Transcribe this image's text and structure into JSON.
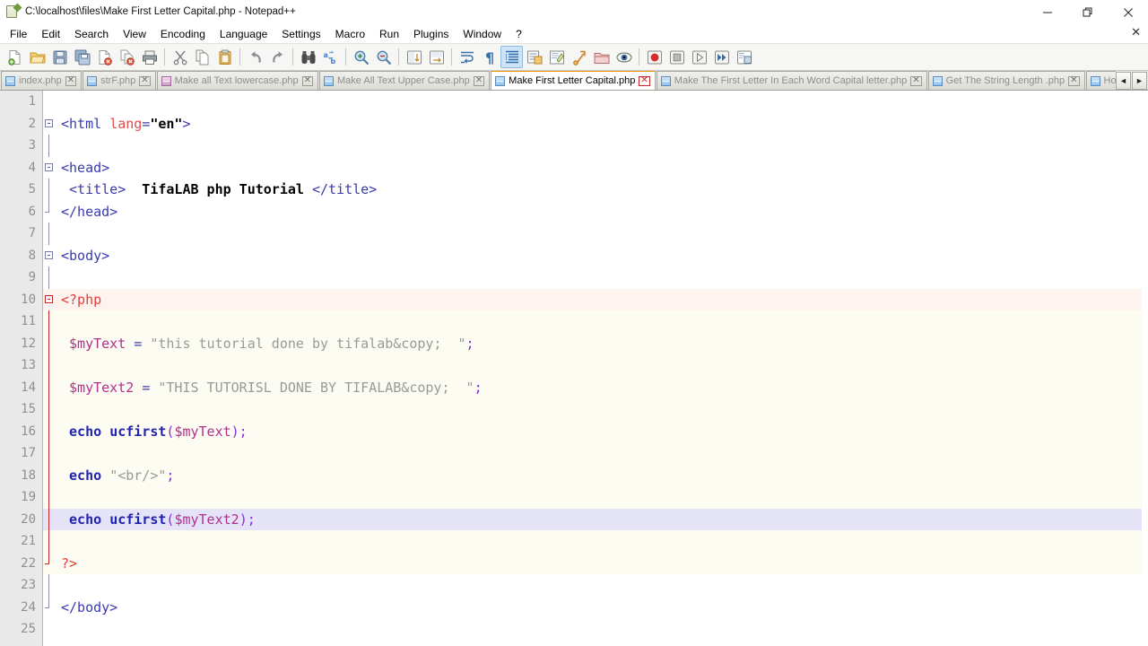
{
  "window": {
    "title": "C:\\localhost\\files\\Make First Letter Capital.php - Notepad++",
    "icon": "notepadpp-icon",
    "minimize_label": "—",
    "restore_label": "❐",
    "close_label": "✕",
    "doc_close_label": "✕"
  },
  "menu": {
    "items": [
      {
        "label": "File"
      },
      {
        "label": "Edit"
      },
      {
        "label": "Search"
      },
      {
        "label": "View"
      },
      {
        "label": "Encoding"
      },
      {
        "label": "Language"
      },
      {
        "label": "Settings"
      },
      {
        "label": "Macro"
      },
      {
        "label": "Run"
      },
      {
        "label": "Plugins"
      },
      {
        "label": "Window"
      },
      {
        "label": "?"
      }
    ]
  },
  "toolbar": {
    "buttons": [
      {
        "name": "new-file",
        "icon": "new-document-icon"
      },
      {
        "name": "open-file",
        "icon": "open-folder-icon"
      },
      {
        "name": "save-file",
        "icon": "floppy-save-icon"
      },
      {
        "name": "save-all",
        "icon": "save-all-icon"
      },
      {
        "name": "close-file",
        "icon": "close-document-icon"
      },
      {
        "name": "close-all",
        "icon": "close-all-documents-icon"
      },
      {
        "name": "print",
        "icon": "printer-icon"
      },
      {
        "name": "separator-1",
        "icon": "separator"
      },
      {
        "name": "cut",
        "icon": "scissors-icon"
      },
      {
        "name": "copy",
        "icon": "copy-pages-icon"
      },
      {
        "name": "paste",
        "icon": "clipboard-paste-icon"
      },
      {
        "name": "separator-2",
        "icon": "separator"
      },
      {
        "name": "undo",
        "icon": "undo-arrow-icon"
      },
      {
        "name": "redo",
        "icon": "redo-arrow-icon"
      },
      {
        "name": "separator-3",
        "icon": "separator"
      },
      {
        "name": "find",
        "icon": "binoculars-icon"
      },
      {
        "name": "replace",
        "icon": "replace-ab-icon"
      },
      {
        "name": "separator-4",
        "icon": "separator"
      },
      {
        "name": "zoom-in",
        "icon": "zoom-in-icon"
      },
      {
        "name": "zoom-out",
        "icon": "zoom-out-icon"
      },
      {
        "name": "separator-5",
        "icon": "separator"
      },
      {
        "name": "sync-vertical-scroll",
        "icon": "sync-vertical-icon"
      },
      {
        "name": "sync-horizontal-scroll",
        "icon": "sync-horizontal-icon"
      },
      {
        "name": "separator-6",
        "icon": "separator"
      },
      {
        "name": "word-wrap",
        "icon": "word-wrap-icon"
      },
      {
        "name": "show-all-characters",
        "icon": "pilcrow-icon"
      },
      {
        "name": "show-indent-guide",
        "icon": "indent-guide-icon",
        "active": true
      },
      {
        "name": "user-defined-dialog",
        "icon": "user-define-icon"
      },
      {
        "name": "document-map",
        "icon": "document-map-icon"
      },
      {
        "name": "function-list",
        "icon": "function-list-icon"
      },
      {
        "name": "folder-as-workspace",
        "icon": "folder-workspace-icon"
      },
      {
        "name": "monitoring",
        "icon": "eye-monitor-icon"
      },
      {
        "name": "separator-7",
        "icon": "separator"
      },
      {
        "name": "start-recording",
        "icon": "record-macro-icon"
      },
      {
        "name": "stop-recording",
        "icon": "stop-macro-icon"
      },
      {
        "name": "play-macro",
        "icon": "play-macro-icon"
      },
      {
        "name": "run-macro-multiple",
        "icon": "fast-forward-macro-icon"
      },
      {
        "name": "save-macro",
        "icon": "save-macro-icon"
      }
    ]
  },
  "tabs": {
    "items": [
      {
        "label": "index.php",
        "active": false,
        "modified": false
      },
      {
        "label": "strF.php",
        "active": false,
        "modified": false
      },
      {
        "label": "Make all Text lowercase.php",
        "active": false,
        "modified": true
      },
      {
        "label": "Make All Text Upper Case.php",
        "active": false,
        "modified": false
      },
      {
        "label": "Make First Letter Capital.php",
        "active": true,
        "modified": false
      },
      {
        "label": "Make The First Letter In Each Word Capital letter.php",
        "active": false,
        "modified": false
      },
      {
        "label": "Get The String Length .php",
        "active": false,
        "modified": false
      },
      {
        "label": "How To Trim a Text.php",
        "active": false,
        "modified": false
      }
    ],
    "close_mark": "✕",
    "scroll_left": "◄",
    "scroll_right": "►"
  },
  "editor": {
    "active_line": 20,
    "caret_line": 20,
    "caret_column": 28,
    "lines": [
      {
        "num": "1",
        "tokens": []
      },
      {
        "num": "2",
        "tokens": [
          {
            "t": "tag",
            "s": "<html"
          },
          {
            "t": "plain",
            "s": " "
          },
          {
            "t": "attr",
            "s": "lang"
          },
          {
            "t": "op",
            "s": "="
          },
          {
            "t": "val",
            "s": "\"en\""
          },
          {
            "t": "tag",
            "s": ">"
          }
        ]
      },
      {
        "num": "3",
        "tokens": []
      },
      {
        "num": "4",
        "tokens": [
          {
            "t": "tag",
            "s": "<head>"
          }
        ]
      },
      {
        "num": "5",
        "tokens": [
          {
            "t": "tag",
            "s": " <title>"
          },
          {
            "t": "strb",
            "s": "  TifaLAB php Tutorial "
          },
          {
            "t": "tag",
            "s": "</title>"
          }
        ]
      },
      {
        "num": "6",
        "tokens": [
          {
            "t": "tag",
            "s": "</head>"
          }
        ]
      },
      {
        "num": "7",
        "tokens": []
      },
      {
        "num": "8",
        "tokens": [
          {
            "t": "tag",
            "s": "<body>"
          }
        ]
      },
      {
        "num": "9",
        "tokens": []
      },
      {
        "num": "10",
        "tokens": [
          {
            "t": "php",
            "s": "<?php"
          }
        ]
      },
      {
        "num": "11",
        "tokens": []
      },
      {
        "num": "12",
        "tokens": [
          {
            "t": "var",
            "s": " $myText"
          },
          {
            "t": "plain",
            "s": " "
          },
          {
            "t": "op",
            "s": "="
          },
          {
            "t": "plain",
            "s": " "
          },
          {
            "t": "str",
            "s": "\"this tutorial done by tifalab&copy;  \""
          },
          {
            "t": "punct",
            "s": ";"
          }
        ]
      },
      {
        "num": "13",
        "tokens": []
      },
      {
        "num": "14",
        "tokens": [
          {
            "t": "var",
            "s": " $myText2"
          },
          {
            "t": "plain",
            "s": " "
          },
          {
            "t": "op",
            "s": "="
          },
          {
            "t": "plain",
            "s": " "
          },
          {
            "t": "str",
            "s": "\"THIS TUTORISL DONE BY TIFALAB&copy;  \""
          },
          {
            "t": "punct",
            "s": ";"
          }
        ]
      },
      {
        "num": "15",
        "tokens": []
      },
      {
        "num": "16",
        "tokens": [
          {
            "t": "kw",
            "s": " echo"
          },
          {
            "t": "plain",
            "s": " "
          },
          {
            "t": "fn",
            "s": "ucfirst"
          },
          {
            "t": "punct",
            "s": "("
          },
          {
            "t": "var",
            "s": "$myText"
          },
          {
            "t": "punct",
            "s": ");"
          }
        ]
      },
      {
        "num": "17",
        "tokens": []
      },
      {
        "num": "18",
        "tokens": [
          {
            "t": "kw",
            "s": " echo"
          },
          {
            "t": "plain",
            "s": " "
          },
          {
            "t": "str",
            "s": "\"<br/>\""
          },
          {
            "t": "punct",
            "s": ";"
          }
        ]
      },
      {
        "num": "19",
        "tokens": []
      },
      {
        "num": "20",
        "tokens": [
          {
            "t": "kw",
            "s": " echo"
          },
          {
            "t": "plain",
            "s": " "
          },
          {
            "t": "fn",
            "s": "ucfirst"
          },
          {
            "t": "punct",
            "s": "("
          },
          {
            "t": "var",
            "s": "$myText2"
          },
          {
            "t": "punct",
            "s": ");"
          }
        ]
      },
      {
        "num": "21",
        "tokens": []
      },
      {
        "num": "22",
        "tokens": [
          {
            "t": "php",
            "s": "?>"
          }
        ]
      },
      {
        "num": "23",
        "tokens": []
      },
      {
        "num": "24",
        "tokens": [
          {
            "t": "tag",
            "s": "</body>"
          }
        ]
      },
      {
        "num": "25",
        "tokens": []
      }
    ]
  },
  "colors": {
    "tab_active_accent": "#f29400",
    "php_block_bg": "#fcfcf2",
    "current_line_bg": "#e4e3f8",
    "gutter_bg": "#e9e9e9",
    "toolbar_bg": "#f6f6f4",
    "tag": "#3a3ab0",
    "attribute": "#e04c4c",
    "php_delimiter": "#e33b3b",
    "variable": "#b0308c",
    "string": "#9a9a9a",
    "keyword": "#2222b0"
  }
}
